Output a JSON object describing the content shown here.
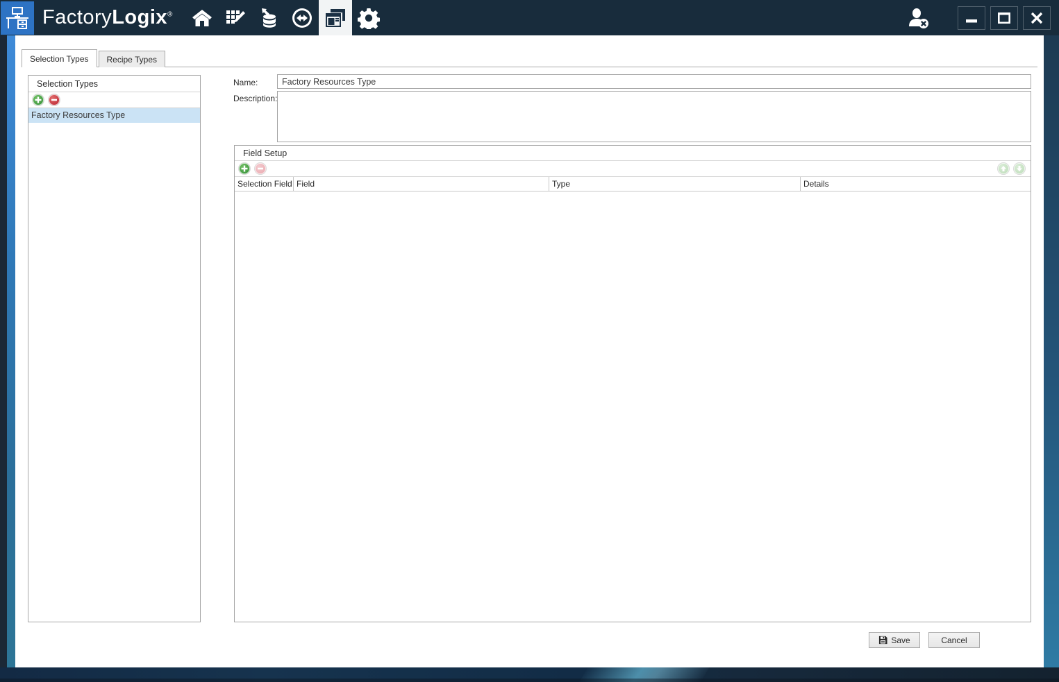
{
  "titlebar": {
    "brand_regular": "Factory",
    "brand_bold": "Logix",
    "brand_mark": "®",
    "nav_icons": [
      {
        "name": "home-icon",
        "active": false
      },
      {
        "name": "grid-edit-icon",
        "active": false
      },
      {
        "name": "database-import-icon",
        "active": false
      },
      {
        "name": "transfer-icon",
        "active": false
      },
      {
        "name": "forms-icon",
        "active": true
      },
      {
        "name": "settings-gear-icon",
        "active": false
      }
    ],
    "window_controls": [
      "minimize",
      "maximize",
      "close"
    ]
  },
  "tabs": [
    {
      "label": "Selection Types",
      "active": true
    },
    {
      "label": "Recipe Types",
      "active": false
    }
  ],
  "left_panel": {
    "title": "Selection Types",
    "toolbar": [
      "add",
      "remove"
    ],
    "items": [
      {
        "label": "Factory Resources Type",
        "selected": true
      }
    ]
  },
  "form": {
    "name_label": "Name:",
    "name_value": "Factory Resources Type",
    "description_label": "Description:",
    "description_value": ""
  },
  "field_setup": {
    "title": "Field Setup",
    "toolbar": [
      "add",
      "remove-disabled",
      "move-up-disabled",
      "move-down-disabled"
    ],
    "columns": [
      "Selection Field",
      "Field",
      "Type",
      "Details"
    ],
    "rows": []
  },
  "footer": {
    "save_label": "Save",
    "cancel_label": "Cancel"
  },
  "colors": {
    "titlebar": "#182c3c",
    "logo_blue": "#2d73c4",
    "selection_highlight": "#cbe3f5",
    "frame_blue": "#3e8ad8",
    "add_green": "#2e8a33",
    "remove_red": "#b71f2e"
  }
}
